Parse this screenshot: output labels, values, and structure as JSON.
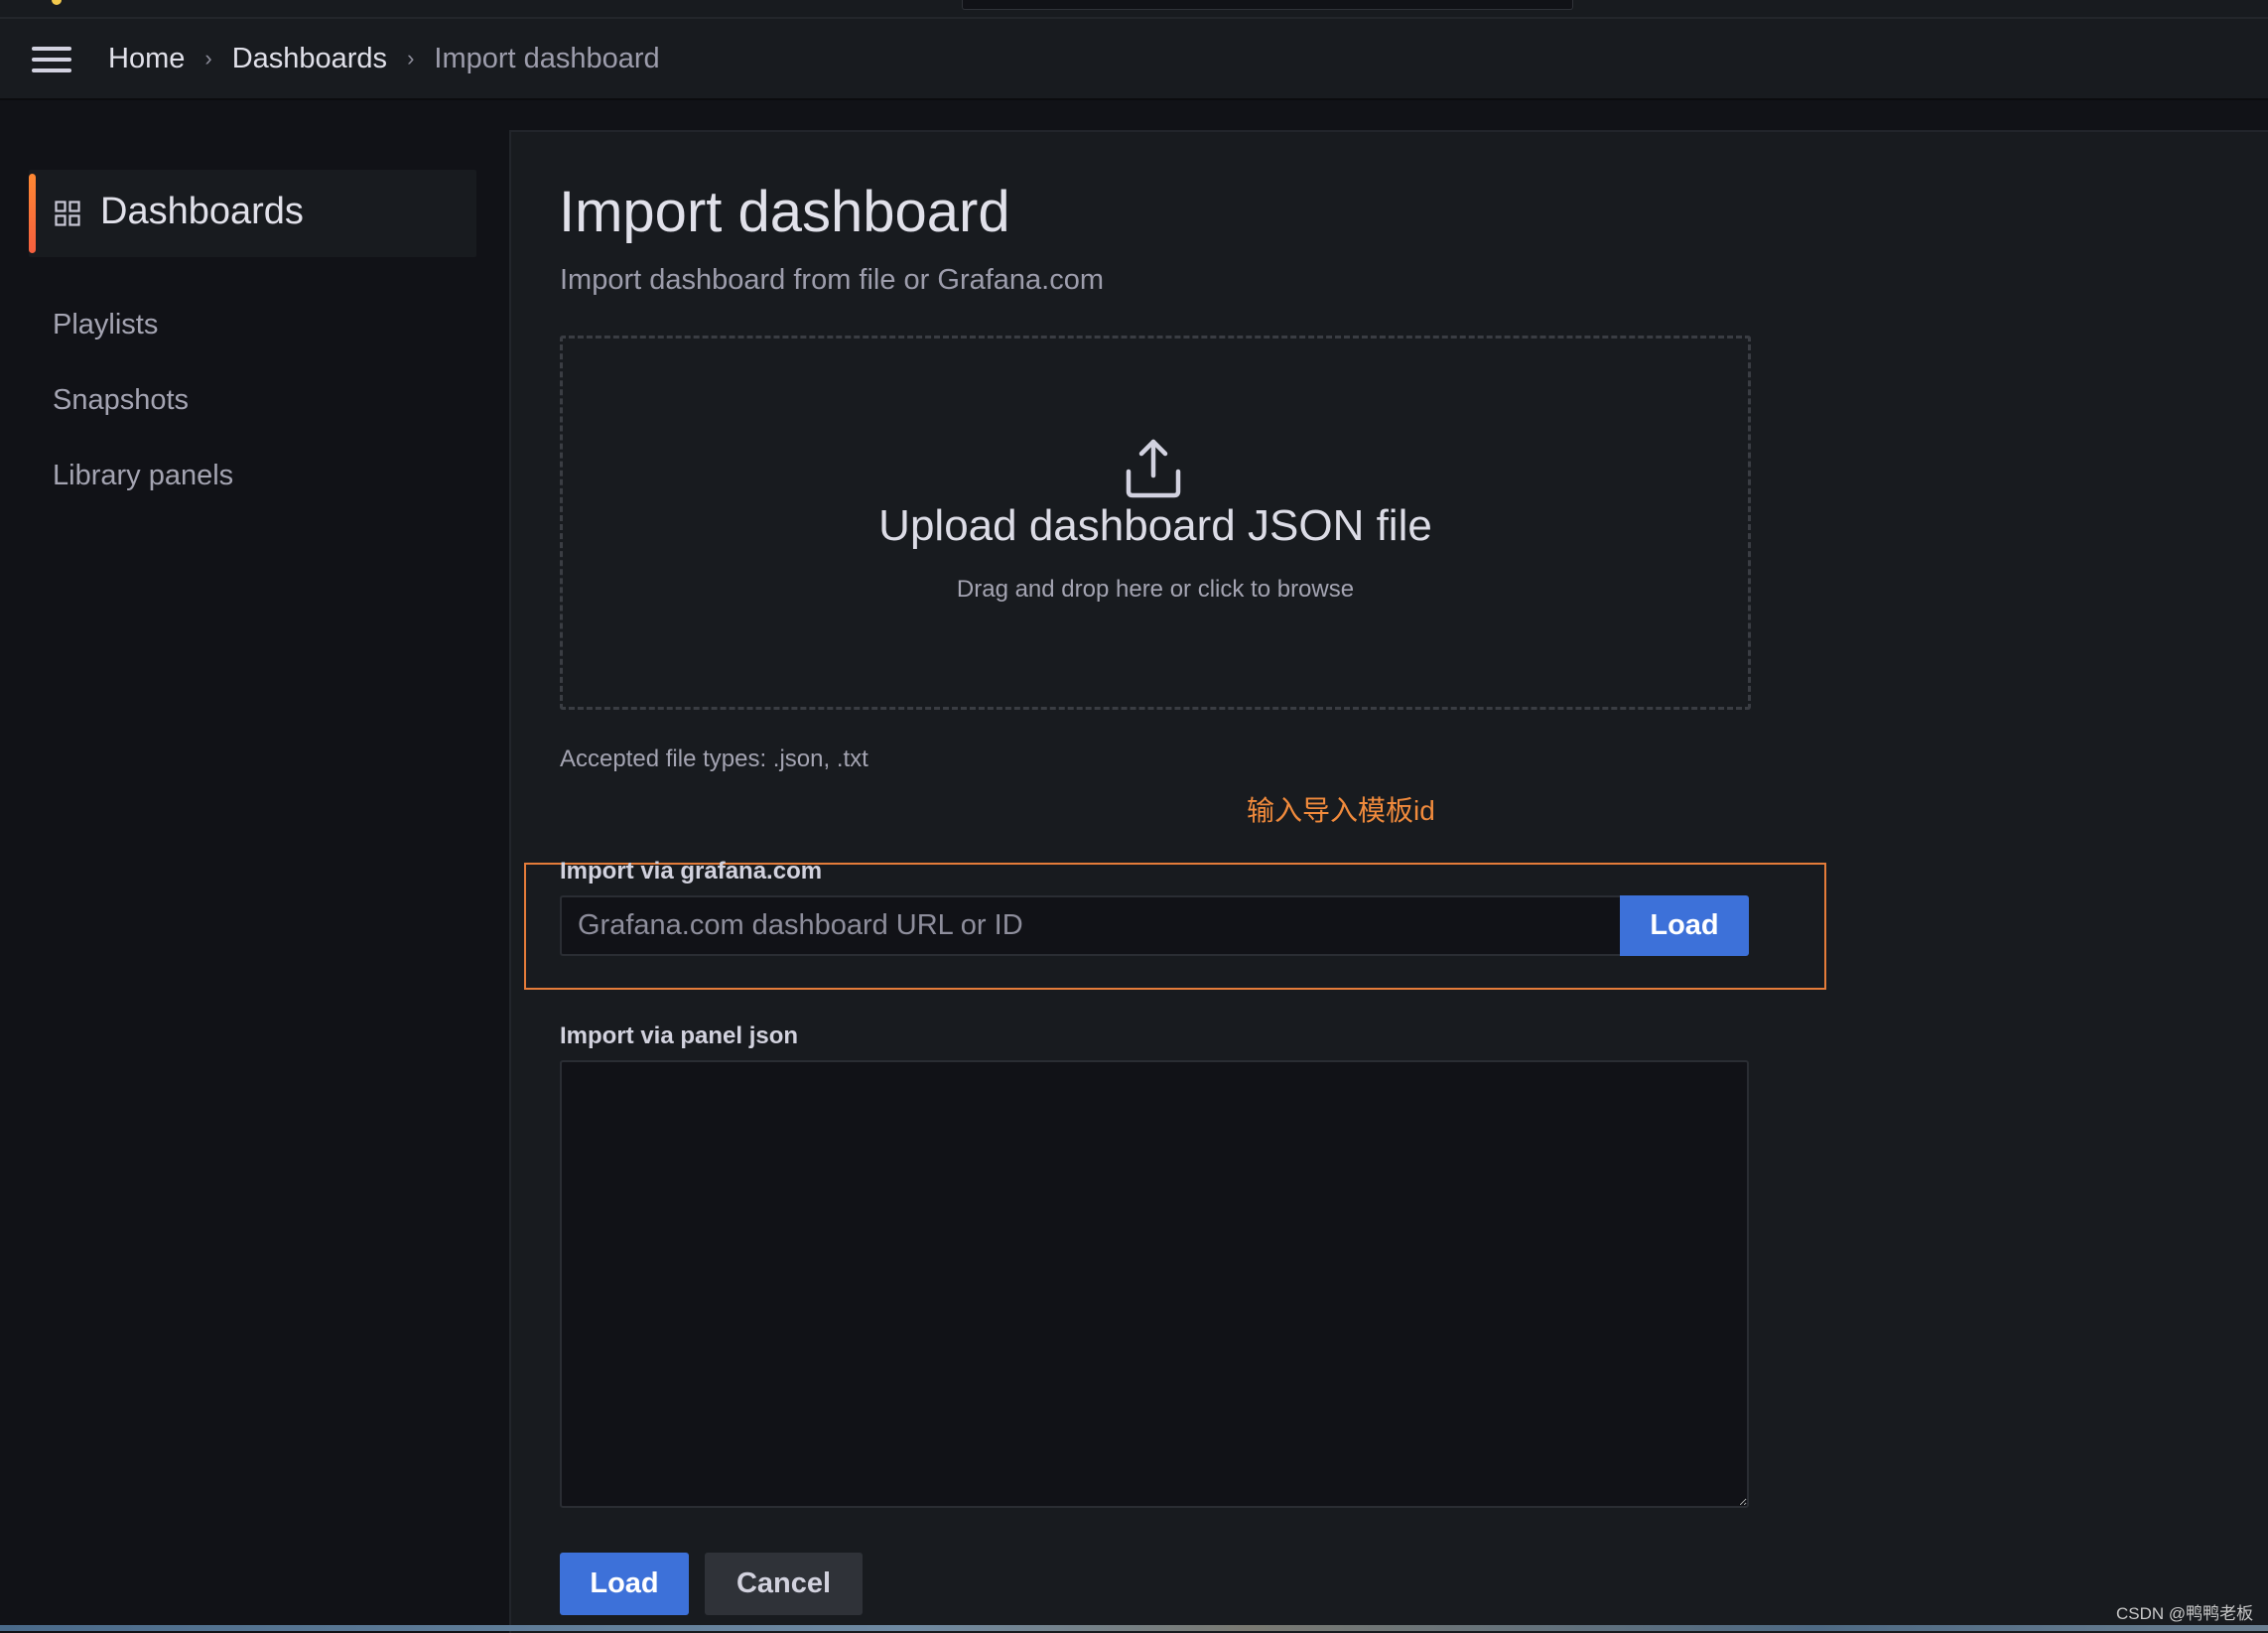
{
  "topbar": {
    "logo_icon": "grafana-logo-icon",
    "search_icon": "search-box"
  },
  "breadcrumb": {
    "menu_icon": "hamburger-icon",
    "items": [
      "Home",
      "Dashboards",
      "Import dashboard"
    ],
    "separator": "›"
  },
  "sidebar": {
    "active": {
      "label": "Dashboards",
      "icon": "apps-grid-icon"
    },
    "items": [
      {
        "label": "Playlists"
      },
      {
        "label": "Snapshots"
      },
      {
        "label": "Library panels"
      }
    ]
  },
  "main": {
    "title": "Import dashboard",
    "subtitle": "Import dashboard from file or Grafana.com",
    "upload": {
      "icon": "upload-icon",
      "title": "Upload dashboard JSON file",
      "hint": "Drag and drop here or click to browse"
    },
    "accepted_types": "Accepted file types: .json, .txt",
    "annotation": "输入导入模板id",
    "grafana_import": {
      "label": "Import via grafana.com",
      "placeholder": "Grafana.com dashboard URL or ID",
      "value": "",
      "button": "Load"
    },
    "panel_json": {
      "label": "Import via panel json",
      "value": ""
    },
    "actions": {
      "load": "Load",
      "cancel": "Cancel"
    }
  },
  "colors": {
    "accent_orange": "#ff8833",
    "primary_blue": "#3d71d9",
    "annotation_orange": "#f08a3c"
  },
  "watermark": "CSDN @鸭鸭老板"
}
